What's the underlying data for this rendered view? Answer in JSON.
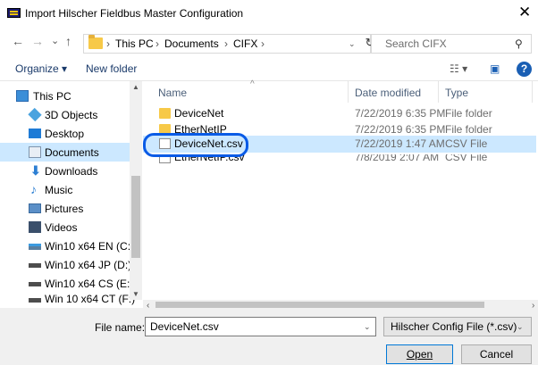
{
  "window": {
    "title": "Import Hilscher Fieldbus Master Configuration",
    "close_label": "✕"
  },
  "nav": {
    "back": "←",
    "forward": "→",
    "recent": "⌄",
    "up": "↑",
    "breadcrumb": [
      "This PC",
      "Documents",
      "CIFX"
    ],
    "separator": "›",
    "dropdown": "⌄",
    "refresh": "↻",
    "search_placeholder": "Search CIFX",
    "search_icon": "⚲"
  },
  "toolbar": {
    "organize": "Organize ▾",
    "new_folder": "New folder",
    "view_icon": "☷ ▾",
    "pane_icon": "▣",
    "help": "?"
  },
  "sidebar": {
    "items": [
      {
        "label": "This PC",
        "icon": "computer-icon",
        "color": "#3b8ed8"
      },
      {
        "label": "3D Objects",
        "icon": "cube-icon",
        "color": "#4aa3df"
      },
      {
        "label": "Desktop",
        "icon": "desktop-icon",
        "color": "#1e7bd6"
      },
      {
        "label": "Documents",
        "icon": "documents-icon",
        "color": "#9ab0c8",
        "selected": true
      },
      {
        "label": "Downloads",
        "icon": "download-icon",
        "color": "#2d7fd3"
      },
      {
        "label": "Music",
        "icon": "music-icon",
        "color": "#2d7fd3"
      },
      {
        "label": "Pictures",
        "icon": "pictures-icon",
        "color": "#5b8fc7"
      },
      {
        "label": "Videos",
        "icon": "videos-icon",
        "color": "#3a4f6b"
      },
      {
        "label": "Win10 x64 EN (C:)",
        "icon": "drive-icon",
        "color": "#5a7fa0"
      },
      {
        "label": "Win10 x64 JP (D:)",
        "icon": "drive-icon",
        "color": "#4d4d4d"
      },
      {
        "label": "Win10 x64 CS (E:)",
        "icon": "drive-icon",
        "color": "#4d4d4d"
      },
      {
        "label": "Win 10 x64 CT (F:)",
        "icon": "drive-icon",
        "color": "#4d4d4d"
      }
    ]
  },
  "files": {
    "columns": {
      "name": "Name",
      "date": "Date modified",
      "type": "Type"
    },
    "rows": [
      {
        "name": "DeviceNet",
        "date": "7/22/2019 6:35 PM",
        "type": "File folder",
        "kind": "folder"
      },
      {
        "name": "EtherNetIP",
        "date": "7/22/2019 6:35 PM",
        "type": "File folder",
        "kind": "folder"
      },
      {
        "name": "DeviceNet.csv",
        "date": "7/22/2019 1:47 AM",
        "type": "CSV File",
        "kind": "csv",
        "selected": true
      },
      {
        "name": "EtherNetIP.csv",
        "date": "7/8/2019 2:07 AM",
        "type": "CSV File",
        "kind": "csv"
      }
    ]
  },
  "footer": {
    "file_name_label": "File name:",
    "file_name_value": "DeviceNet.csv",
    "file_type_value": "Hilscher Config File (*.csv)",
    "open_label": "Open",
    "cancel_label": "Cancel"
  },
  "colors": {
    "accent": "#0a5be6",
    "selection": "#cce8ff",
    "folder": "#f7c948"
  }
}
